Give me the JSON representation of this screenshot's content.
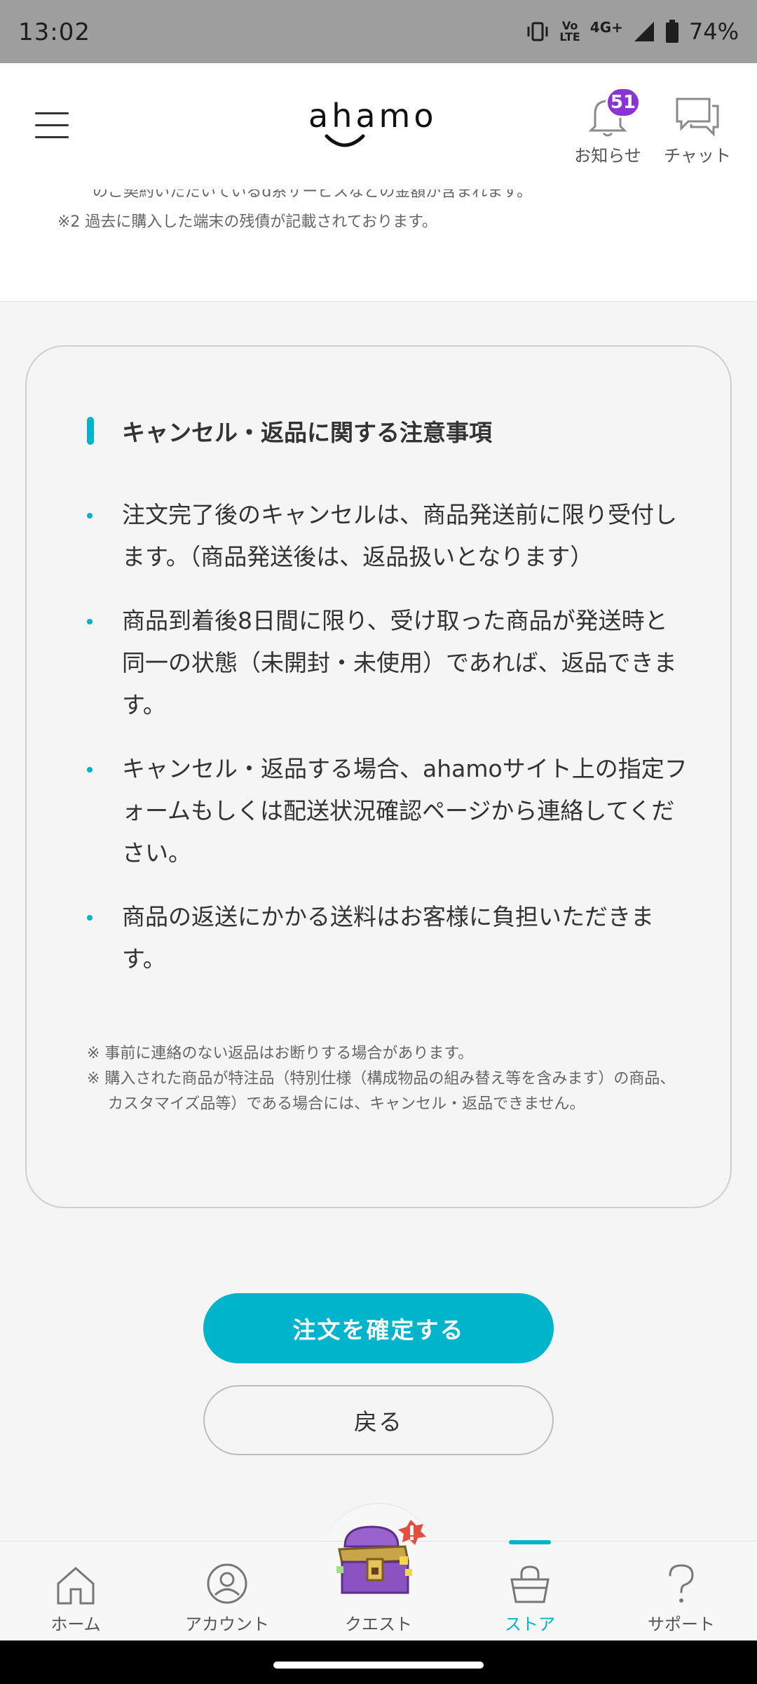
{
  "status_bar": {
    "time": "13:02",
    "volte_top": "Vo",
    "volte_bottom": "LTE",
    "network": "4G+",
    "battery": "74%"
  },
  "header": {
    "logo": "ahamo",
    "notifications_label": "お知らせ",
    "notifications_count": "51",
    "chat_label": "チャット"
  },
  "top_card": {
    "partial_line": "のご契約いただいているd系サービスなどの金額が含まれます。",
    "note_2": "※2 過去に購入した端末の残債が記載されております。"
  },
  "notice": {
    "title": "キャンセル・返品に関する注意事項",
    "bullets": [
      "注文完了後のキャンセルは、商品発送前に限り受付します。（商品発送後は、返品扱いとなります）",
      "商品到着後8日間に限り、受け取った商品が発送時と同一の状態（未開封・未使用）であれば、返品できます。",
      "キャンセル・返品する場合、ahamoサイト上の指定フォームもしくは配送状況確認ページから連絡してください。",
      "商品の返送にかかる送料はお客様に負担いただきます。"
    ],
    "fine_print": [
      "※ 事前に連絡のない返品はお断りする場合があります。",
      "※ 購入された商品が特注品（特別仕様（構成物品の組み替え等を含みます）の商品、カスタマイズ品等）である場合には、キャンセル・返品できません。"
    ]
  },
  "actions": {
    "confirm_label": "注文を確定する",
    "back_label": "戻る"
  },
  "bottom_nav": {
    "items": [
      {
        "label": "ホーム",
        "icon": "home-icon"
      },
      {
        "label": "アカウント",
        "icon": "account-icon"
      },
      {
        "label": "クエスト",
        "icon": "treasure-chest-icon"
      },
      {
        "label": "ストア",
        "icon": "shopping-bag-icon",
        "active": true
      },
      {
        "label": "サポート",
        "icon": "question-icon"
      }
    ]
  },
  "colors": {
    "accent": "#00b4cc",
    "badge": "#8b34d6",
    "quest_alert": "#e84c3d"
  }
}
